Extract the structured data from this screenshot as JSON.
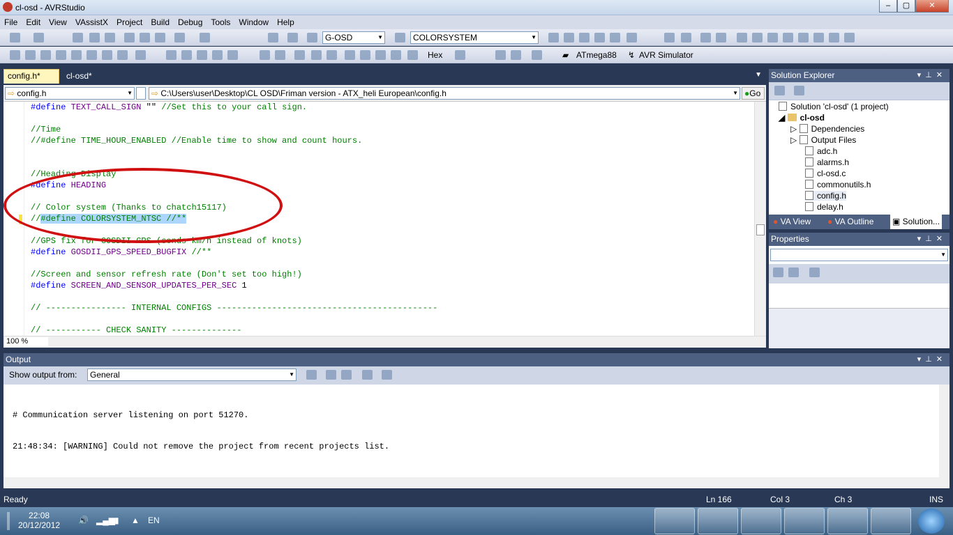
{
  "window": {
    "title": "cl-osd - AVRStudio",
    "min": "–",
    "max": "▢",
    "close": "✕"
  },
  "menu": [
    "File",
    "Edit",
    "View",
    "VAssistX",
    "Project",
    "Build",
    "Debug",
    "Tools",
    "Window",
    "Help"
  ],
  "toolbar1": {
    "config_combo": "G-OSD",
    "find_combo": "COLORSYSTEM"
  },
  "toolbar2": {
    "hex_label": "Hex",
    "device": "ATmega88",
    "tool": "AVR Simulator"
  },
  "tabs": {
    "active": "config.h*",
    "other": "cl-osd*"
  },
  "navbar": {
    "file_combo": "config.h",
    "path": "C:\\Users\\user\\Desktop\\CL OSD\\Friman version - ATX_heli European\\config.h",
    "go": "Go"
  },
  "code_lines": [
    "#define TEXT_CALL_SIGN \"\" //Set this to your call sign.",
    "",
    "//Time",
    "//#define TIME_HOUR_ENABLED //Enable time to show and count hours.",
    "",
    "",
    "//Heading Display",
    "#define HEADING",
    "",
    "// Color system (Thanks to chatch15117)",
    "//#define COLORSYSTEM_NTSC //**",
    "",
    "//GPS fix for GOSDII GPS (sends km/h instead of knots)",
    "#define GOSDII_GPS_SPEED_BUGFIX //**",
    "",
    "//Screen and sensor refresh rate (Don't set too high!)",
    "#define SCREEN_AND_SENSOR_UPDATES_PER_SEC 1",
    "",
    "// ---------------- INTERNAL CONFIGS --------------------------------------------",
    "",
    "// ----------- CHECK SANITY --------------"
  ],
  "zoom": "100 %",
  "solution_explorer": {
    "title": "Solution Explorer",
    "solution": "Solution 'cl-osd' (1 project)",
    "project": "cl-osd",
    "items": [
      "Dependencies",
      "Output Files",
      "adc.h",
      "alarms.h",
      "cl-osd.c",
      "commonutils.h",
      "config.h",
      "delay.h"
    ],
    "bottom_tabs": [
      "VA View",
      "VA Outline",
      "Solution..."
    ]
  },
  "properties": {
    "title": "Properties"
  },
  "output": {
    "title": "Output",
    "show_label": "Show output from:",
    "source": "General",
    "lines": [
      "# Communication server listening on port 51270.",
      "21:48:34: [WARNING] Could not remove the project from recent projects list."
    ]
  },
  "status": {
    "ready": "Ready",
    "ln": "Ln 166",
    "col": "Col 3",
    "ch": "Ch 3",
    "ins": "INS"
  },
  "taskbar": {
    "time": "22:08",
    "date": "20/12/2012",
    "lang": "EN"
  }
}
